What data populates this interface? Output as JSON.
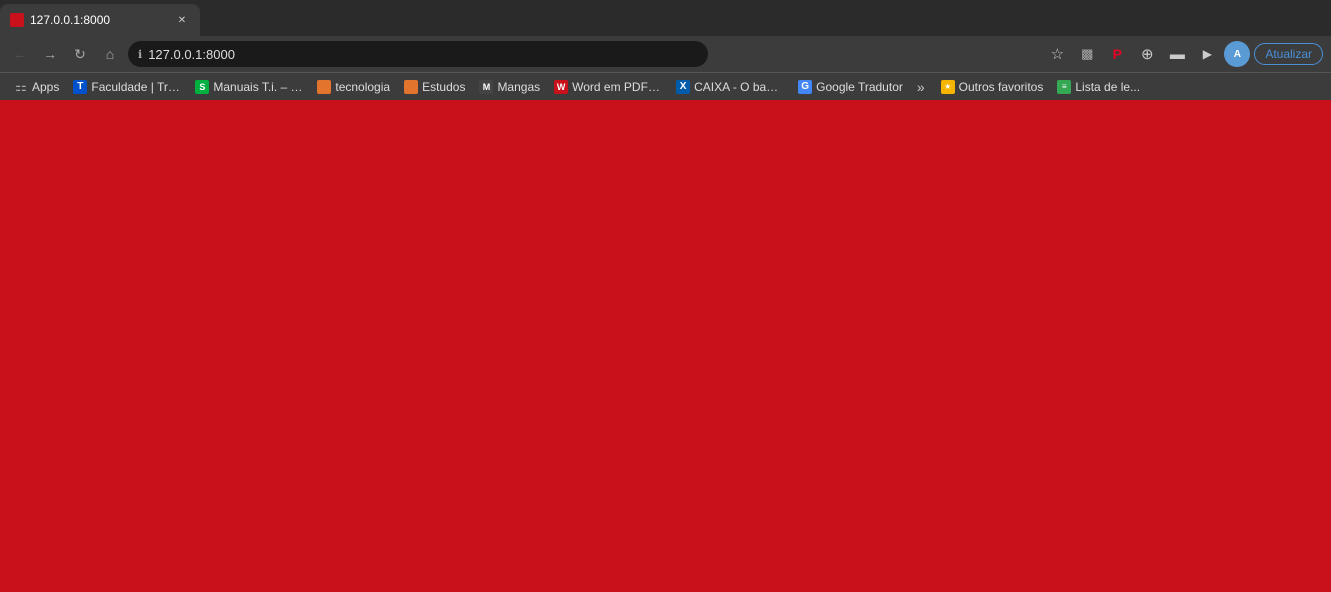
{
  "browser": {
    "tab": {
      "title": "127.0.0.1:8000",
      "favicon_color": "#c8111a"
    },
    "address_bar": {
      "url": "127.0.0.1:8000",
      "lock_icon": "ℹ",
      "back_disabled": false,
      "forward_disabled": false
    },
    "toolbar": {
      "update_label": "Atualizar"
    },
    "bookmarks": [
      {
        "id": "apps",
        "label": "Apps",
        "fav_class": "fav-apps",
        "icon": "⚏"
      },
      {
        "id": "trello",
        "label": "Faculdade | Trello",
        "fav_class": "fav-trello",
        "icon": "T"
      },
      {
        "id": "suporte",
        "label": "Manuais T.i. – Hom...",
        "fav_class": "fav-suporte",
        "icon": "S"
      },
      {
        "id": "tecnologia",
        "label": "tecnologia",
        "fav_class": "fav-tecnologia",
        "icon": "▪"
      },
      {
        "id": "estudos",
        "label": "Estudos",
        "fav_class": "fav-estudos",
        "icon": "▪"
      },
      {
        "id": "mangas",
        "label": "Mangas",
        "fav_class": "fav-mangas",
        "icon": "M"
      },
      {
        "id": "word",
        "label": "Word em PDF - Co...",
        "fav_class": "fav-word",
        "icon": "W"
      },
      {
        "id": "caixa",
        "label": "CAIXA - O banco q...",
        "fav_class": "fav-caixa",
        "icon": "X"
      },
      {
        "id": "google",
        "label": "Google Tradutor",
        "fav_class": "fav-google",
        "icon": "G"
      }
    ],
    "bookmarks_overflow": "»",
    "outros_favoritos": "Outros favoritos",
    "lista_leitura": "Lista de le..."
  },
  "page": {
    "background_color": "#c8111a"
  }
}
